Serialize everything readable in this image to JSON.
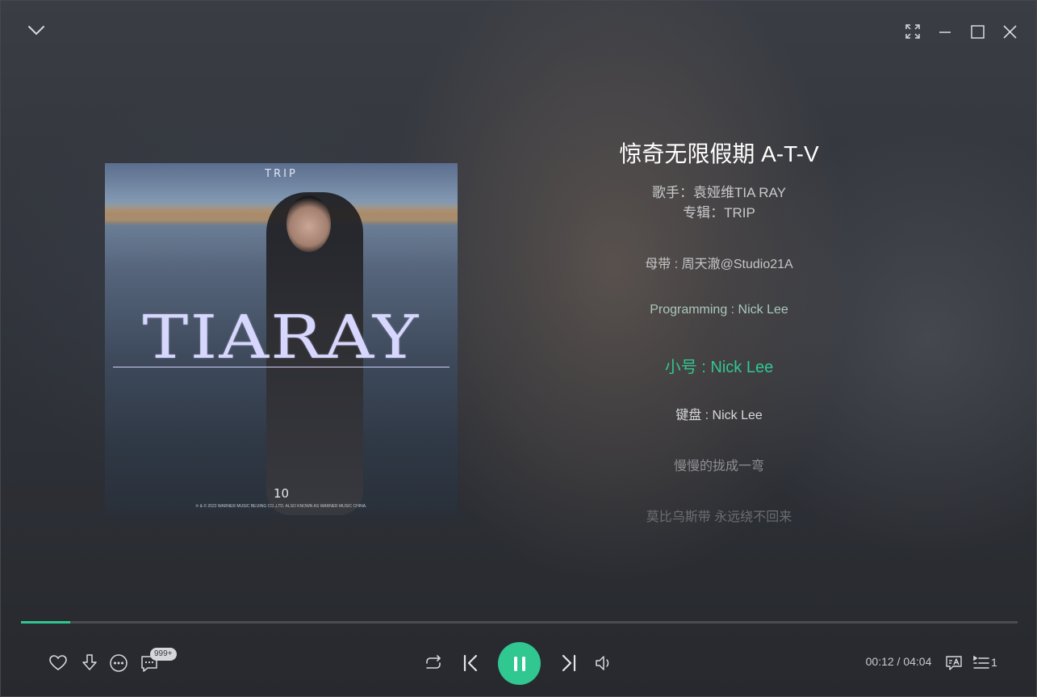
{
  "window_controls": {
    "collapse_icon": "chevron-down-icon",
    "fullscreen_icon": "fullscreen-icon",
    "minimize_icon": "minimize-icon",
    "maximize_icon": "maximize-icon",
    "close_icon": "close-icon"
  },
  "album_cover": {
    "brand": "TRIP",
    "wordmark": "TIARAY",
    "track_no": "10",
    "copyright": "℗ & © 2022 WARNER MUSIC BEIJING CO.,LTD. ALSO KNOWN AS WARNER MUSIC CHINA."
  },
  "song": {
    "title": "惊奇无限假期 A-T-V",
    "artist_line": "歌手：袁娅维TIA RAY",
    "album_line": "专辑：TRIP"
  },
  "lyrics": [
    {
      "text": "母带 : 周天澈@Studio21A",
      "state": "past"
    },
    {
      "text": "Programming : Nick Lee",
      "state": "past"
    },
    {
      "text": "小号 : Nick Lee",
      "state": "current"
    },
    {
      "text": "键盘 : Nick Lee",
      "state": "upcoming"
    },
    {
      "text": "慢慢的拢成一弯",
      "state": "upcoming"
    },
    {
      "text": "莫比乌斯带 永远绕不回来",
      "state": "upcoming"
    }
  ],
  "playback": {
    "progress_fraction": 0.049,
    "time_display": "00:12 / 04:04",
    "comment_badge": "999+",
    "queue_count": "1",
    "accent_color": "#31c790"
  },
  "controls_icons": {
    "like": "heart-icon",
    "download": "download-icon",
    "more": "more-icon",
    "comment": "comment-icon",
    "loop": "loop-icon",
    "prev": "previous-icon",
    "play_pause": "pause-icon",
    "next": "next-icon",
    "volume": "volume-icon",
    "lyrics_translate": "lyrics-translate-icon",
    "playlist": "playlist-icon"
  }
}
